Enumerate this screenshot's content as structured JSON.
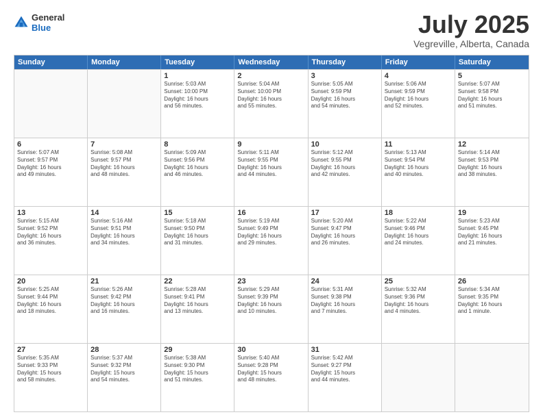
{
  "header": {
    "logo_line1": "General",
    "logo_line2": "Blue",
    "month": "July 2025",
    "location": "Vegreville, Alberta, Canada"
  },
  "weekdays": [
    "Sunday",
    "Monday",
    "Tuesday",
    "Wednesday",
    "Thursday",
    "Friday",
    "Saturday"
  ],
  "rows": [
    [
      {
        "day": "",
        "text": ""
      },
      {
        "day": "",
        "text": ""
      },
      {
        "day": "1",
        "text": "Sunrise: 5:03 AM\nSunset: 10:00 PM\nDaylight: 16 hours\nand 56 minutes."
      },
      {
        "day": "2",
        "text": "Sunrise: 5:04 AM\nSunset: 10:00 PM\nDaylight: 16 hours\nand 55 minutes."
      },
      {
        "day": "3",
        "text": "Sunrise: 5:05 AM\nSunset: 9:59 PM\nDaylight: 16 hours\nand 54 minutes."
      },
      {
        "day": "4",
        "text": "Sunrise: 5:06 AM\nSunset: 9:59 PM\nDaylight: 16 hours\nand 52 minutes."
      },
      {
        "day": "5",
        "text": "Sunrise: 5:07 AM\nSunset: 9:58 PM\nDaylight: 16 hours\nand 51 minutes."
      }
    ],
    [
      {
        "day": "6",
        "text": "Sunrise: 5:07 AM\nSunset: 9:57 PM\nDaylight: 16 hours\nand 49 minutes."
      },
      {
        "day": "7",
        "text": "Sunrise: 5:08 AM\nSunset: 9:57 PM\nDaylight: 16 hours\nand 48 minutes."
      },
      {
        "day": "8",
        "text": "Sunrise: 5:09 AM\nSunset: 9:56 PM\nDaylight: 16 hours\nand 46 minutes."
      },
      {
        "day": "9",
        "text": "Sunrise: 5:11 AM\nSunset: 9:55 PM\nDaylight: 16 hours\nand 44 minutes."
      },
      {
        "day": "10",
        "text": "Sunrise: 5:12 AM\nSunset: 9:55 PM\nDaylight: 16 hours\nand 42 minutes."
      },
      {
        "day": "11",
        "text": "Sunrise: 5:13 AM\nSunset: 9:54 PM\nDaylight: 16 hours\nand 40 minutes."
      },
      {
        "day": "12",
        "text": "Sunrise: 5:14 AM\nSunset: 9:53 PM\nDaylight: 16 hours\nand 38 minutes."
      }
    ],
    [
      {
        "day": "13",
        "text": "Sunrise: 5:15 AM\nSunset: 9:52 PM\nDaylight: 16 hours\nand 36 minutes."
      },
      {
        "day": "14",
        "text": "Sunrise: 5:16 AM\nSunset: 9:51 PM\nDaylight: 16 hours\nand 34 minutes."
      },
      {
        "day": "15",
        "text": "Sunrise: 5:18 AM\nSunset: 9:50 PM\nDaylight: 16 hours\nand 31 minutes."
      },
      {
        "day": "16",
        "text": "Sunrise: 5:19 AM\nSunset: 9:49 PM\nDaylight: 16 hours\nand 29 minutes."
      },
      {
        "day": "17",
        "text": "Sunrise: 5:20 AM\nSunset: 9:47 PM\nDaylight: 16 hours\nand 26 minutes."
      },
      {
        "day": "18",
        "text": "Sunrise: 5:22 AM\nSunset: 9:46 PM\nDaylight: 16 hours\nand 24 minutes."
      },
      {
        "day": "19",
        "text": "Sunrise: 5:23 AM\nSunset: 9:45 PM\nDaylight: 16 hours\nand 21 minutes."
      }
    ],
    [
      {
        "day": "20",
        "text": "Sunrise: 5:25 AM\nSunset: 9:44 PM\nDaylight: 16 hours\nand 18 minutes."
      },
      {
        "day": "21",
        "text": "Sunrise: 5:26 AM\nSunset: 9:42 PM\nDaylight: 16 hours\nand 16 minutes."
      },
      {
        "day": "22",
        "text": "Sunrise: 5:28 AM\nSunset: 9:41 PM\nDaylight: 16 hours\nand 13 minutes."
      },
      {
        "day": "23",
        "text": "Sunrise: 5:29 AM\nSunset: 9:39 PM\nDaylight: 16 hours\nand 10 minutes."
      },
      {
        "day": "24",
        "text": "Sunrise: 5:31 AM\nSunset: 9:38 PM\nDaylight: 16 hours\nand 7 minutes."
      },
      {
        "day": "25",
        "text": "Sunrise: 5:32 AM\nSunset: 9:36 PM\nDaylight: 16 hours\nand 4 minutes."
      },
      {
        "day": "26",
        "text": "Sunrise: 5:34 AM\nSunset: 9:35 PM\nDaylight: 16 hours\nand 1 minute."
      }
    ],
    [
      {
        "day": "27",
        "text": "Sunrise: 5:35 AM\nSunset: 9:33 PM\nDaylight: 15 hours\nand 58 minutes."
      },
      {
        "day": "28",
        "text": "Sunrise: 5:37 AM\nSunset: 9:32 PM\nDaylight: 15 hours\nand 54 minutes."
      },
      {
        "day": "29",
        "text": "Sunrise: 5:38 AM\nSunset: 9:30 PM\nDaylight: 15 hours\nand 51 minutes."
      },
      {
        "day": "30",
        "text": "Sunrise: 5:40 AM\nSunset: 9:28 PM\nDaylight: 15 hours\nand 48 minutes."
      },
      {
        "day": "31",
        "text": "Sunrise: 5:42 AM\nSunset: 9:27 PM\nDaylight: 15 hours\nand 44 minutes."
      },
      {
        "day": "",
        "text": ""
      },
      {
        "day": "",
        "text": ""
      }
    ]
  ]
}
